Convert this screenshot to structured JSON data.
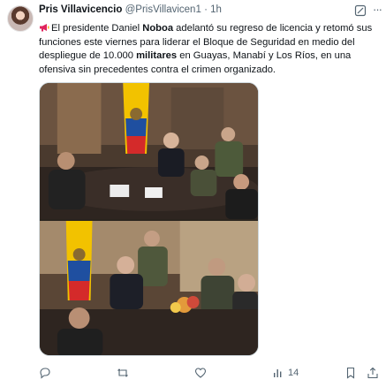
{
  "tweet": {
    "author": {
      "display_name": "Pris Villavicencio",
      "handle": "@PrisVillavicen1",
      "separator": "·",
      "time": "1h"
    },
    "body": {
      "emoji": "megaphone-icon",
      "part1": "El presidente Daniel ",
      "bold1": "Noboa",
      "part2": " adelantó su regreso de licencia y retomó sus funciones este viernes para liderar el Bloque de Seguridad en medio del despliegue de 10.000 ",
      "bold2": "militares",
      "part3": " en Guayas, Manabí y Los Ríos, en una ofensiva sin precedentes contra el crimen organizado."
    },
    "media": [
      {
        "name": "photo-meeting-1",
        "description_icon": "photo"
      },
      {
        "name": "photo-meeting-2",
        "description_icon": "photo"
      }
    ],
    "actions": {
      "reply": {
        "icon": "reply-icon",
        "count": ""
      },
      "repost": {
        "icon": "repost-icon",
        "count": ""
      },
      "like": {
        "icon": "heart-icon",
        "count": ""
      },
      "views": {
        "icon": "views-icon",
        "count": "14"
      },
      "bookmark": {
        "icon": "bookmark-icon"
      },
      "share": {
        "icon": "share-icon"
      }
    },
    "colors": {
      "text": "#0f1419",
      "secondary": "#536471",
      "border": "#cfd9de"
    }
  }
}
